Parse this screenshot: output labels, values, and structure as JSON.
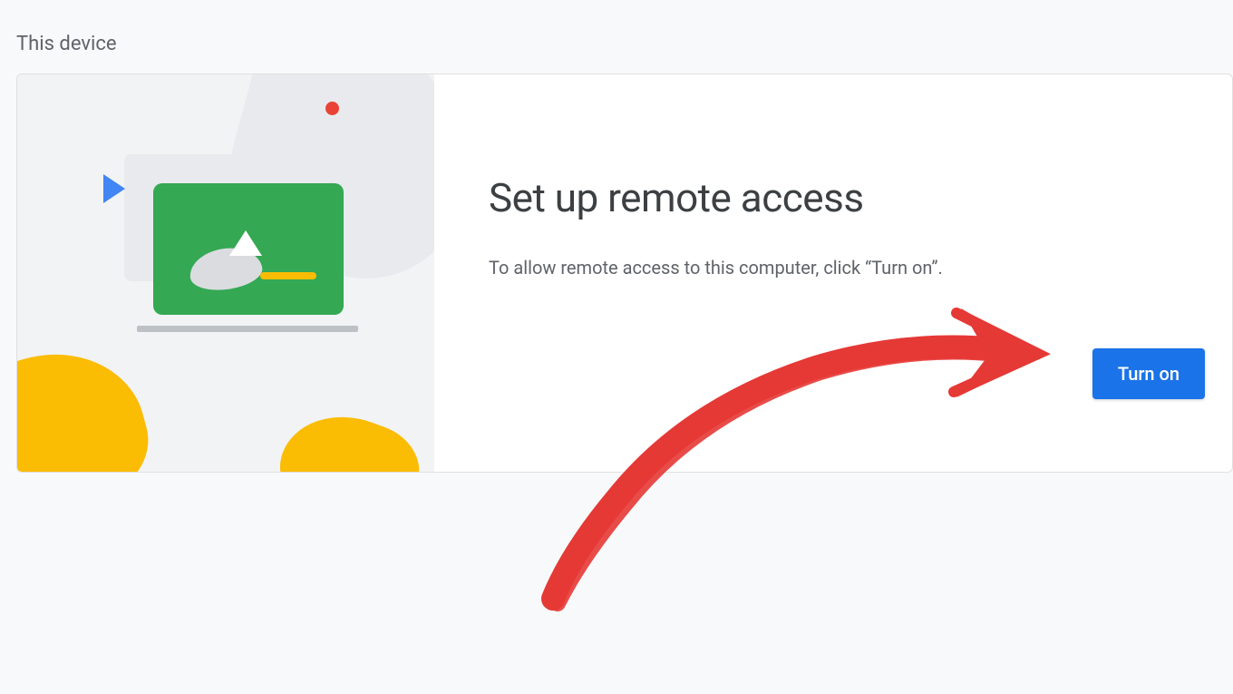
{
  "section": {
    "label": "This device"
  },
  "card": {
    "heading": "Set up remote access",
    "description": "To allow remote access to this computer, click “Turn on”.",
    "button_label": "Turn on"
  },
  "annotation": {
    "type": "arrow",
    "color": "#e53935",
    "points_to": "turn-on-button"
  }
}
